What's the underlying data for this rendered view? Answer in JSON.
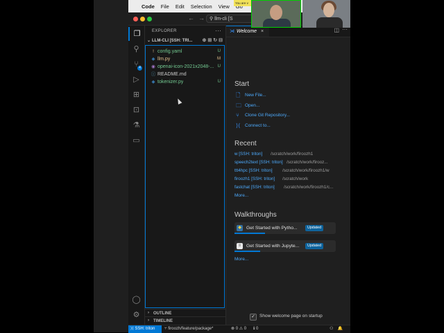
{
  "macos_menubar": {
    "app_name": "Code",
    "items": [
      "File",
      "Edit",
      "Selection",
      "View",
      "Go"
    ]
  },
  "call_banner": "You are v",
  "titlebar": {
    "command_center": "llm-cli [S"
  },
  "explorer": {
    "title": "EXPLORER",
    "more": "···",
    "workspace": "LLM-CLI [SSH: TRI...",
    "files": [
      {
        "name": "config.yaml",
        "icon": "!",
        "badge": "U",
        "status": "untracked"
      },
      {
        "name": "llm.py",
        "icon": "◆",
        "badge": "M",
        "status": "modified"
      },
      {
        "name": "openai-icon-2021x2048-...",
        "icon": "◉",
        "badge": "U",
        "status": "untracked"
      },
      {
        "name": "README.md",
        "icon": "ⓘ",
        "badge": "",
        "status": "plain"
      },
      {
        "name": "tokenizer.py",
        "icon": "◆",
        "badge": "U",
        "status": "untracked"
      }
    ],
    "outline": "OUTLINE",
    "timeline": "TIMELINE"
  },
  "tab": {
    "label": "Welcome",
    "close": "×"
  },
  "welcome": {
    "start_heading": "Start",
    "start_items": [
      {
        "icon": "new-file-icon",
        "label": "New File..."
      },
      {
        "icon": "open-folder-icon",
        "label": "Open..."
      },
      {
        "icon": "git-branch-icon",
        "label": "Clone Git Repository..."
      },
      {
        "icon": "remote-icon",
        "label": "Connect to..."
      }
    ],
    "recent_heading": "Recent",
    "recent": [
      {
        "name": "w [SSH: triton]",
        "path": "/scratch/work/firoozh1"
      },
      {
        "name": "speech2text [SSH: triton]",
        "path": "/scratch/work/firooz..."
      },
      {
        "name": "ttt4hpc [SSH: triton]",
        "path": "/scratch/work/firoozh1/w"
      },
      {
        "name": "firoozh1 [SSH: triton]",
        "path": "/scratch/work"
      },
      {
        "name": "fastchat [SSH: triton]",
        "path": "/scratch/work/firoozh1/c..."
      }
    ],
    "recent_more": "More...",
    "walkthroughs_heading": "Walkthroughs",
    "walkthroughs": [
      {
        "label": "Get Started with Pytho...",
        "badge": "Updated",
        "progress": 0.3,
        "icon_color": "#3572a5"
      },
      {
        "label": "Get Started with Jupyte...",
        "badge": "Updated",
        "progress": 0.25,
        "icon_color": "#e8e8e8"
      }
    ],
    "walkthroughs_more": "More...",
    "startup_checkbox_label": "Show welcome page on startup",
    "startup_checked": true
  },
  "statusbar": {
    "remote": "⟩⟨ SSH: triton",
    "branch": "firoozh/feature/package*",
    "problems": "⊗ 0 ⚠ 0",
    "ports": "ℹ 0"
  },
  "colors": {
    "accent": "#0078d4",
    "link": "#4daafc",
    "untracked": "#73c991",
    "modified": "#e2c08d"
  }
}
